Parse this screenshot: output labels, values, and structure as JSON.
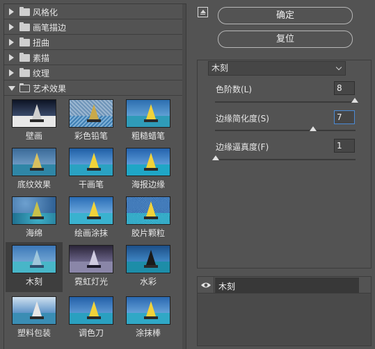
{
  "gallery": {
    "categories": [
      {
        "label": "风格化",
        "expanded": false
      },
      {
        "label": "画笔描边",
        "expanded": false
      },
      {
        "label": "扭曲",
        "expanded": false
      },
      {
        "label": "素描",
        "expanded": false
      },
      {
        "label": "纹理",
        "expanded": false
      },
      {
        "label": "艺术效果",
        "expanded": true
      }
    ],
    "filters": [
      {
        "label": "壁画",
        "selected": false
      },
      {
        "label": "彩色铅笔",
        "selected": false
      },
      {
        "label": "粗糙蜡笔",
        "selected": false
      },
      {
        "label": "底纹效果",
        "selected": false
      },
      {
        "label": "干画笔",
        "selected": false
      },
      {
        "label": "海报边缘",
        "selected": false
      },
      {
        "label": "海绵",
        "selected": false
      },
      {
        "label": "绘画涂抹",
        "selected": false
      },
      {
        "label": "胶片颗粒",
        "selected": false
      },
      {
        "label": "木刻",
        "selected": true
      },
      {
        "label": "霓虹灯光",
        "selected": false
      },
      {
        "label": "水彩",
        "selected": false
      },
      {
        "label": "塑料包装",
        "selected": false
      },
      {
        "label": "调色刀",
        "selected": false
      },
      {
        "label": "涂抹棒",
        "selected": false
      }
    ]
  },
  "buttons": {
    "ok_label": "确定",
    "reset_label": "复位"
  },
  "settings": {
    "filter_selected": "木刻",
    "params": [
      {
        "label": "色阶数(L)",
        "value": "8",
        "fraction": 1.0,
        "focused": false
      },
      {
        "label": "边缘简化度(S)",
        "value": "7",
        "fraction": 0.7,
        "focused": true
      },
      {
        "label": "边缘逼真度(F)",
        "value": "1",
        "fraction": 0.0,
        "focused": false
      }
    ]
  },
  "effect_layers": {
    "items": [
      {
        "name": "木刻",
        "visible": true
      }
    ]
  },
  "colors": {
    "background": "#535353",
    "focus_border": "#4b8bd6"
  }
}
